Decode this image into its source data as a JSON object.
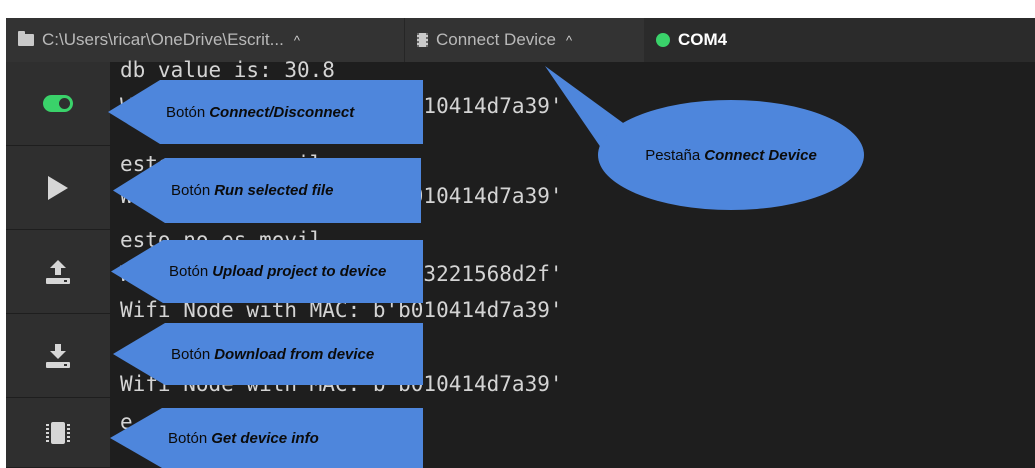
{
  "tabs": [
    {
      "label": "C:\\Users\\ricar\\OneDrive\\Escrit...",
      "icon": "folder-icon",
      "caret": "^"
    },
    {
      "label": "Connect Device",
      "icon": "chip-icon",
      "caret": "^"
    },
    {
      "label": "COM4",
      "icon": "status-dot-icon",
      "status_color": "#3ad26a"
    }
  ],
  "sidebar": [
    {
      "icon": "toggle-icon",
      "action": "connect-disconnect"
    },
    {
      "icon": "play-icon",
      "action": "run-selected-file"
    },
    {
      "icon": "upload-icon",
      "action": "upload-project"
    },
    {
      "icon": "download-icon",
      "action": "download-from-device"
    },
    {
      "icon": "chip-icon",
      "action": "get-device-info"
    }
  ],
  "terminal_lines": [
    "db value is: 30.8",
    "Wifi Node with MAC: b'b010414d7a39'",
    "esto no es movil",
    "Wifi Node with MAC: b'b010414d7a39'",
    "esto no es movil",
    "Wifi Node with MAC: b'123221568d2f'",
    "Wifi Node with MAC: b'b010414d7a39'",
    "Wifi Node with MAC: b'b010414d7a39'",
    "e"
  ],
  "callouts": [
    {
      "prefix": "Botón",
      "emph": "Connect/Disconnect"
    },
    {
      "prefix": "Botón",
      "emph": "Run selected file"
    },
    {
      "prefix": "Botón",
      "emph": "Upload project to device"
    },
    {
      "prefix": "Botón",
      "emph": "Download from device"
    },
    {
      "prefix": "Botón",
      "emph": "Get device info"
    }
  ],
  "bubble": {
    "prefix": "Pestaña",
    "emph": "Connect Device"
  },
  "colors": {
    "accent": "#4e86dc",
    "status_green": "#3ad26a",
    "background": "#1e1e1e"
  }
}
